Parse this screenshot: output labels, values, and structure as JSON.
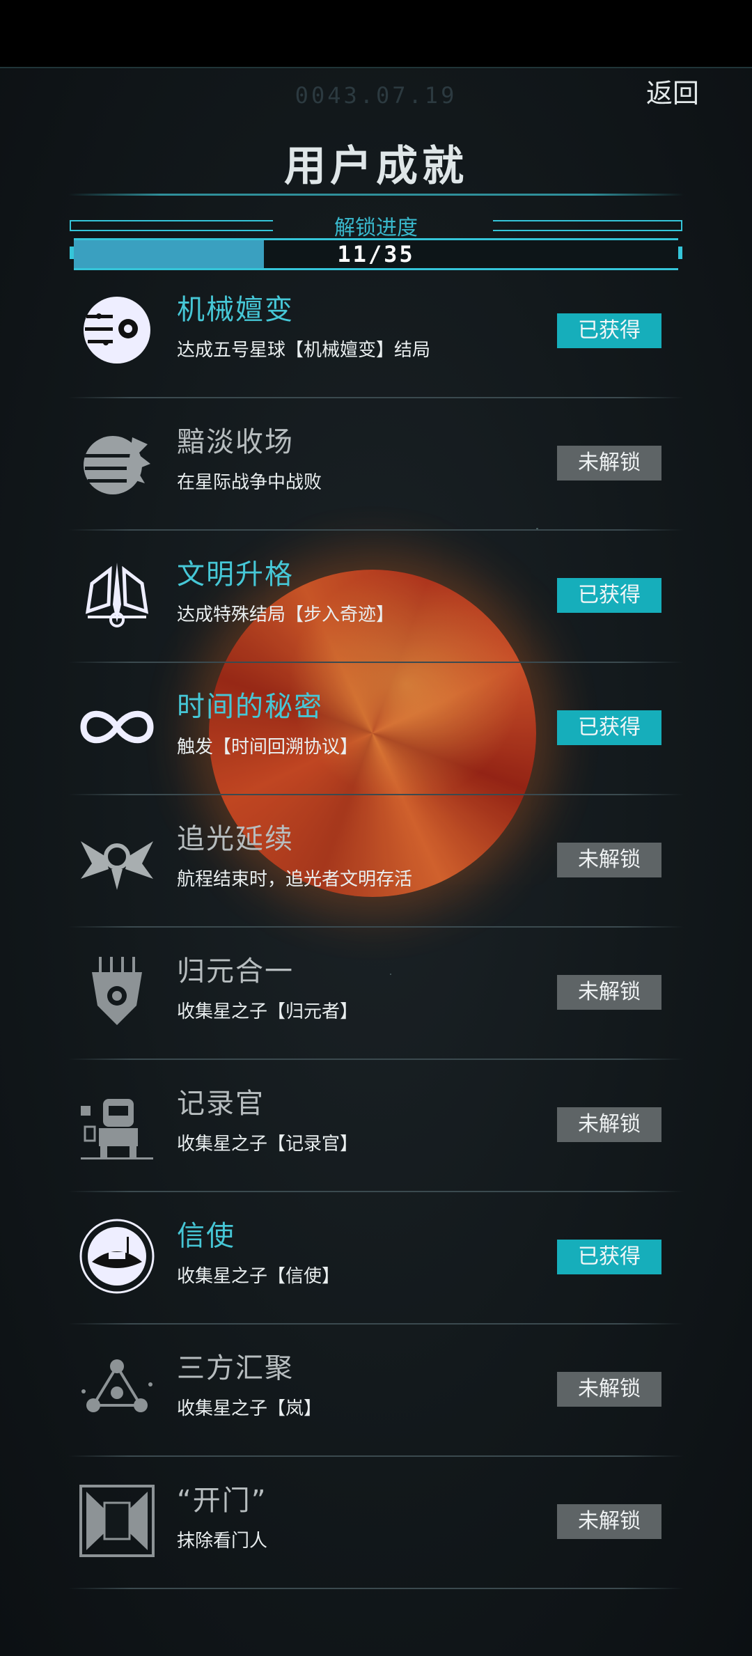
{
  "header": {
    "date": "0043.07.19",
    "back_label": "返回",
    "title": "用户成就"
  },
  "progress": {
    "label": "解锁进度",
    "text": "11/35",
    "fraction": 0.314
  },
  "colors": {
    "accent": "#46c7d6",
    "badge_obtained": "#16aebb",
    "badge_locked": "#5e6466"
  },
  "achievements": [
    {
      "name": "机械嬗变",
      "desc": "达成五号星球【机械嬗变】结局",
      "status": "已获得",
      "obtained": true,
      "icon": "robot-eye-icon"
    },
    {
      "name": "黯淡收场",
      "desc": "在星际战争中战败",
      "status": "未解锁",
      "obtained": false,
      "icon": "shattered-planet-icon"
    },
    {
      "name": "文明升格",
      "desc": "达成特殊结局【步入奇迹】",
      "status": "已获得",
      "obtained": true,
      "icon": "winged-emblem-icon"
    },
    {
      "name": "时间的秘密",
      "desc": "触发【时间回溯协议】",
      "status": "已获得",
      "obtained": true,
      "icon": "infinity-icon"
    },
    {
      "name": "追光延续",
      "desc": "航程结束时，追光者文明存活",
      "status": "未解锁",
      "obtained": false,
      "icon": "winged-ship-icon"
    },
    {
      "name": "归元合一",
      "desc": "收集星之子【归元者】",
      "status": "未解锁",
      "obtained": false,
      "icon": "mask-icon"
    },
    {
      "name": "记录官",
      "desc": "收集星之子【记录官】",
      "status": "未解锁",
      "obtained": false,
      "icon": "recorder-robot-icon"
    },
    {
      "name": "信使",
      "desc": "收集星之子【信使】",
      "status": "已获得",
      "obtained": true,
      "icon": "messenger-ship-icon"
    },
    {
      "name": "三方汇聚",
      "desc": "收集星之子【岚】",
      "status": "未解锁",
      "obtained": false,
      "icon": "triangle-nodes-icon"
    },
    {
      "name": "“开门”",
      "desc": "抹除看门人",
      "status": "未解锁",
      "obtained": false,
      "icon": "gate-icon"
    }
  ]
}
